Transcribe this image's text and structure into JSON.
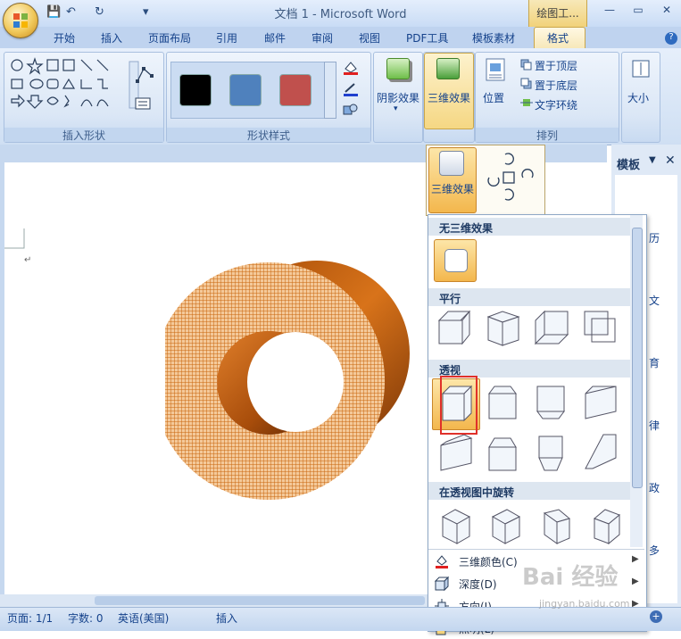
{
  "window": {
    "title": "文档 1 - Microsoft Word",
    "tools_group": "绘图工...",
    "min": "—",
    "restore": "▭",
    "close": "✕"
  },
  "qat": {
    "save": "💾",
    "undo": "↶",
    "redo": "↻",
    "customize": "▾"
  },
  "tabs": [
    "开始",
    "插入",
    "页面布局",
    "引用",
    "邮件",
    "审阅",
    "视图",
    "PDF工具",
    "模板素材",
    "格式"
  ],
  "help": "?",
  "ribbon": {
    "insert_shapes": {
      "label": "插入形状"
    },
    "shape_styles": {
      "label": "形状样式",
      "swatches": [
        "#000000",
        "#4f81bd",
        "#c0504d"
      ]
    },
    "shadow": {
      "label": "阴影效果"
    },
    "threed": {
      "label": "三维效果"
    },
    "arrange": {
      "label": "排列",
      "position": "位置",
      "bring_front": "置于顶层",
      "send_back": "置于底层",
      "wrap": "文字环绕"
    },
    "size": {
      "label": "大小"
    }
  },
  "popup": {
    "threed_button": "三维效果"
  },
  "menu": {
    "sections": [
      {
        "title": "无三维效果"
      },
      {
        "title": "平行"
      },
      {
        "title": "透视"
      },
      {
        "title": "在透视图中旋转"
      }
    ],
    "items": [
      {
        "label": "三维颜色(C)",
        "icon": "paint-bucket-icon"
      },
      {
        "label": "深度(D)",
        "icon": "depth-icon"
      },
      {
        "label": "方向(I)",
        "icon": "direction-icon"
      },
      {
        "label": "照明(L)",
        "icon": "lighting-icon"
      }
    ]
  },
  "sidepane": {
    "title": "模板",
    "items": [
      "历",
      "文",
      "育",
      "律",
      "政",
      "多"
    ]
  },
  "status": {
    "page": "页面: 1/1",
    "words": "字数: 0",
    "language": "英语(美国)",
    "mode": "插入"
  },
  "watermark": {
    "main": "Bai 经验",
    "sub": "jingyan.baidu.com"
  },
  "colors": {
    "accent": "#c9650c",
    "selection": "#e0302a"
  }
}
